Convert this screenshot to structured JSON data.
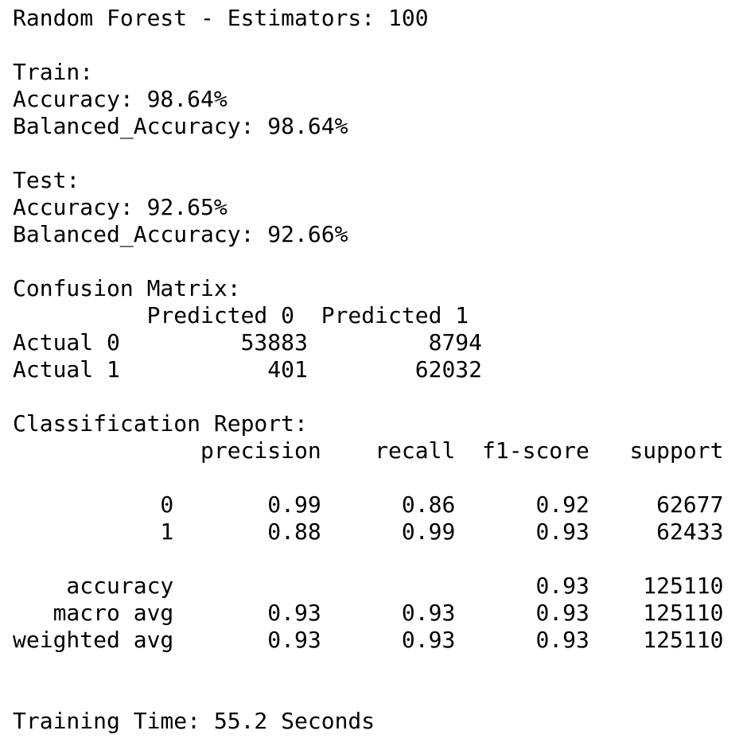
{
  "model_header": "Random Forest - Estimators: 100",
  "train": {
    "heading": "Train:",
    "accuracy": "Accuracy: 98.64%",
    "balanced_accuracy": "Balanced_Accuracy: 98.64%"
  },
  "test": {
    "heading": "Test:",
    "accuracy": "Accuracy: 92.65%",
    "balanced_accuracy": "Balanced_Accuracy: 92.66%"
  },
  "confusion_matrix": {
    "heading": "Confusion Matrix:",
    "header_row": "          Predicted 0  Predicted 1",
    "rows": [
      "Actual 0         53883         8794",
      "Actual 1           401        62032"
    ]
  },
  "classification_report": {
    "heading": "Classification Report:",
    "header_row": "              precision    recall  f1-score   support",
    "class_rows": [
      "           0       0.99      0.86      0.92     62677",
      "           1       0.88      0.99      0.93     62433"
    ],
    "summary_rows": [
      "    accuracy                           0.93    125110",
      "   macro avg       0.93      0.93      0.93    125110",
      "weighted avg       0.93      0.93      0.93    125110"
    ]
  },
  "training_time": "Training Time: 55.2 Seconds"
}
